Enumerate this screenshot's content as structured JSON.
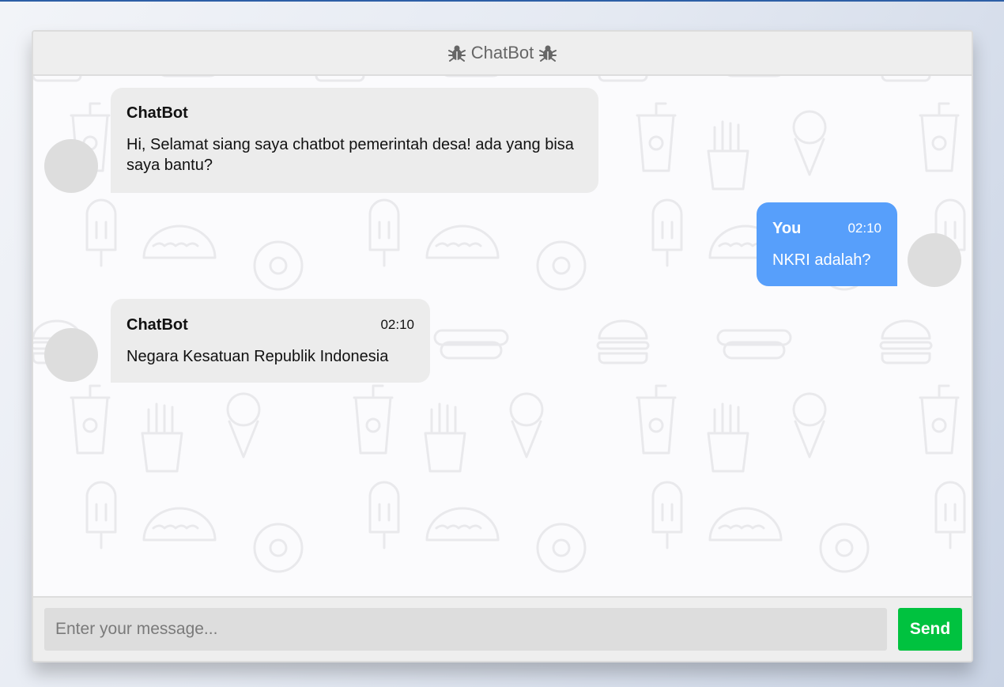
{
  "header": {
    "title": "ChatBot",
    "left_icon": "bug-icon",
    "right_icon": "bug-icon"
  },
  "messages": [
    {
      "sender": "ChatBot",
      "side": "left",
      "time": "",
      "text": "Hi, Selamat siang saya chatbot pemerintah desa! ada yang bisa saya bantu?"
    },
    {
      "sender": "You",
      "side": "right",
      "time": "02:10",
      "text": "NKRI adalah?"
    },
    {
      "sender": "ChatBot",
      "side": "left",
      "time": "02:10",
      "text": "Negara Kesatuan Republik Indonesia"
    }
  ],
  "input": {
    "placeholder": "Enter your message...",
    "value": ""
  },
  "send_button": {
    "label": "Send"
  },
  "colors": {
    "bot_bubble": "#ececec",
    "user_bubble": "#579ffb",
    "send_button": "#00c23f",
    "header_bg": "#eeeeee"
  }
}
